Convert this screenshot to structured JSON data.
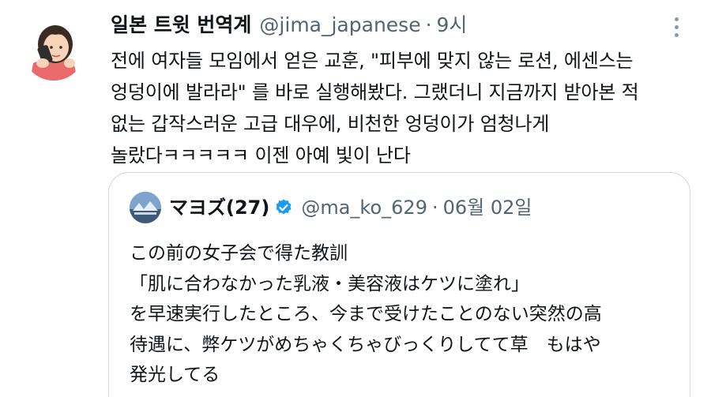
{
  "tweet": {
    "author_name": "일본 트윗 번역계",
    "author_handle": "@jima_japanese",
    "separator": "·",
    "time": "9시",
    "text_lines": [
      "전에 여자들 모임에서 얻은 교훈, \"피부에 맞지 않는 로션, 에센스는",
      "엉덩이에 발라라\" 를 바로 실행해봤다. 그랬더니 지금까지 받아본 적",
      "없는 갑작스러운 고급 대우에, 비천한 엉덩이가 엄청나게",
      "놀랐다ㅋㅋㅋㅋㅋ 이젠 아예 빛이 난다"
    ]
  },
  "quoted_tweet": {
    "author_name": "マヨズ(27)",
    "author_handle": "@ma_ko_629",
    "separator": "·",
    "date": "06월 02일",
    "text_lines": [
      "この前の女子会で得た教訓",
      "「肌に合わなかった乳液・美容液はケツに塗れ」",
      "を早速実行したところ、今まで受けたことのない突然の高",
      "待遇に、弊ケツがめちゃくちゃびっくりしてて草　もはや",
      "発光してる"
    ]
  },
  "colors": {
    "text": "#0f1419",
    "secondary_text": "#536471",
    "border": "#cfd9de",
    "verified": "#1d9bf0"
  },
  "icons": [
    "avatar-illustration",
    "more-options-icon",
    "verified-badge-icon"
  ]
}
